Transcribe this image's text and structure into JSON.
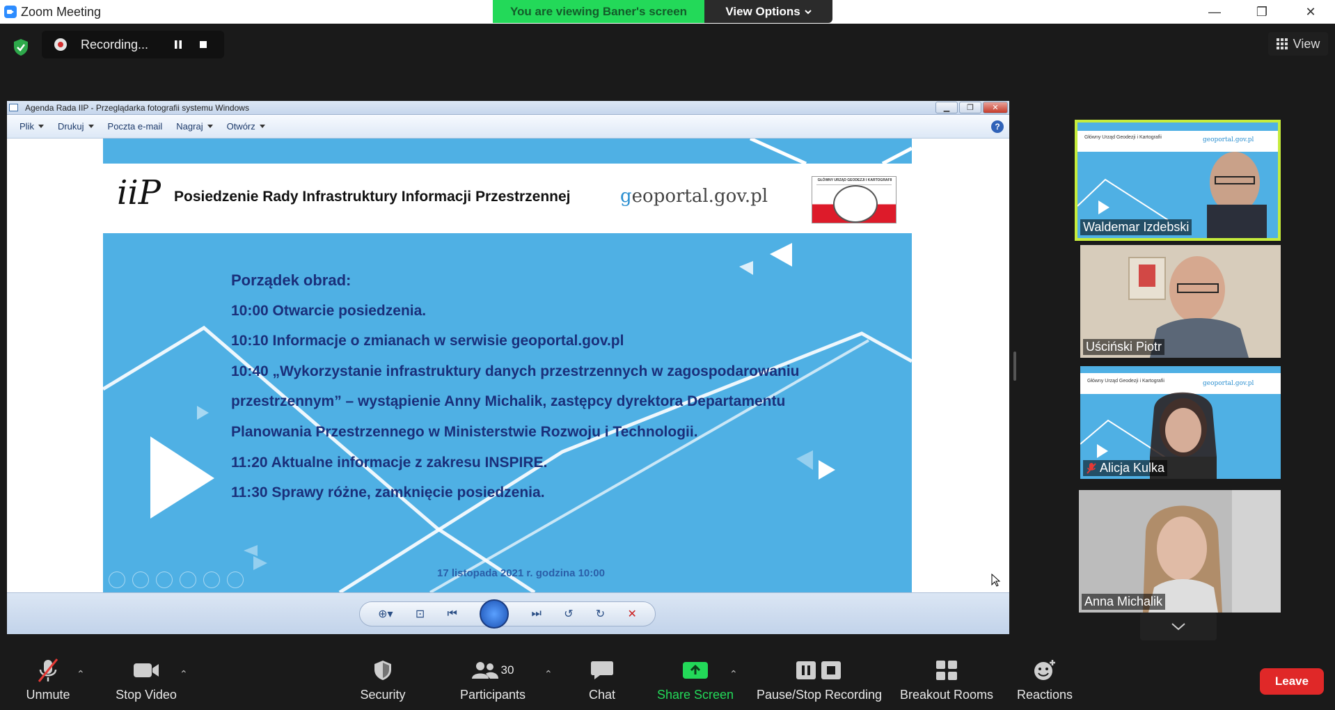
{
  "window": {
    "title": "Zoom Meeting",
    "viewing_banner": "You are viewing Baner's screen",
    "view_options": "View Options",
    "minimize": "—",
    "restore": "❐",
    "close": "✕"
  },
  "top": {
    "recording_label": "Recording...",
    "view_label": "View"
  },
  "shared_window": {
    "title": "Agenda Rada IIP - Przeglądarka fotografii systemu Windows",
    "menu": [
      "Plik",
      "Drukuj",
      "Poczta e-mail",
      "Nagraj",
      "Otwórz"
    ],
    "help": "?"
  },
  "slide": {
    "logo": "iiP",
    "title": "Posiedzenie Rady Infrastruktury Informacji Przestrzennej",
    "geoportal_prefix": "g",
    "geoportal_rest": "eoportal.gov.pl",
    "gugik_caption": "GŁÓWNY URZĄD GEODEZJI I KARTOGRAFII",
    "agenda_heading": "Porządek obrad:",
    "agenda_lines": [
      "10:00 Otwarcie posiedzenia.",
      "10:10 Informacje o zmianach w serwisie geoportal.gov.pl",
      "10:40 „Wykorzystanie infrastruktury danych przestrzennych w zagospodarowaniu",
      "przestrzennym” – wystąpienie Anny Michalik, zastępcy dyrektora Departamentu",
      "Planowania Przestrzennego w Ministerstwie Rozwoju i Technologii.",
      "11:20 Aktualne informacje z zakresu INSPIRE.",
      "11:30 Sprawy różne, zamknięcie posiedzenia."
    ],
    "date": "17 listopada 2021 r. godzina 10:00"
  },
  "participants": [
    {
      "name": "Waldemar Izdebski",
      "active": true,
      "muted": false,
      "thumb_header": "Główny Urząd Geodezji i Kartografii",
      "thumb_brand": "geoportal.gov.pl"
    },
    {
      "name": "Uściński Piotr",
      "active": false,
      "muted": false
    },
    {
      "name": "Alicja Kulka",
      "active": false,
      "muted": true,
      "thumb_header": "Główny Urząd Geodezji i Kartografii",
      "thumb_brand": "geoportal.gov.pl"
    },
    {
      "name": "Anna Michalik",
      "active": false,
      "muted": false
    }
  ],
  "controls": {
    "unmute": "Unmute",
    "stop_video": "Stop Video",
    "security": "Security",
    "participants": "Participants",
    "participants_count": "30",
    "chat": "Chat",
    "share_screen": "Share Screen",
    "pause_stop_recording": "Pause/Stop Recording",
    "breakout_rooms": "Breakout Rooms",
    "reactions": "Reactions",
    "leave": "Leave"
  },
  "colors": {
    "accent_green": "#23d959",
    "leave_red": "#e02828",
    "slide_blue": "#4fb0e4",
    "agenda_text": "#1a2f7a",
    "active_speaker": "#c6ec3c"
  }
}
